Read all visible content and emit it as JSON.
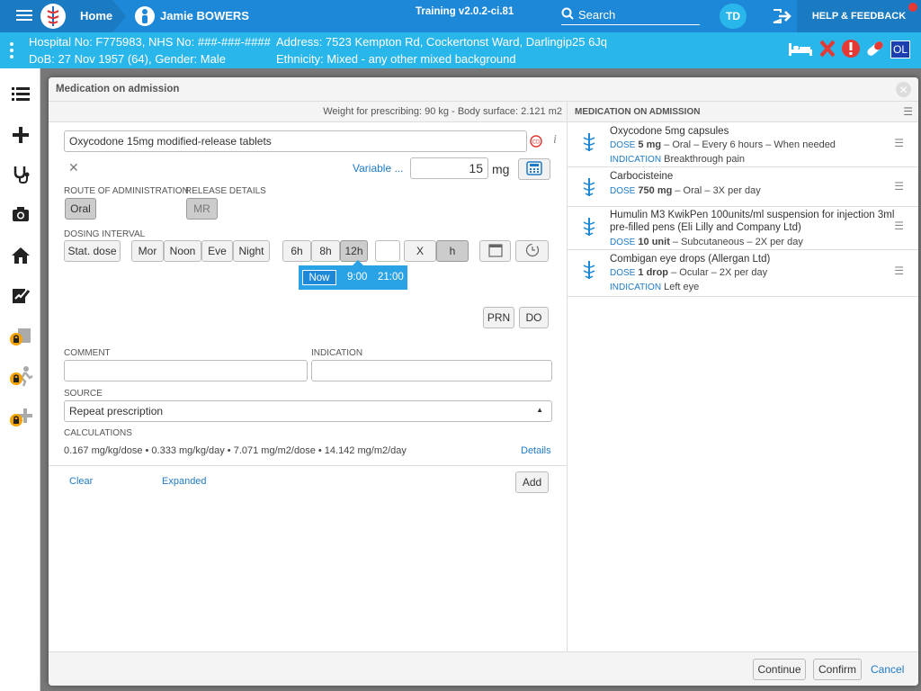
{
  "topbar": {
    "home": "Home",
    "user": "Jamie BOWERS",
    "version": "Training v2.0.2-ci.81",
    "search": "Search",
    "initials": "TD",
    "help": "HELP & FEEDBACK"
  },
  "patient": {
    "line1a": "Hospital No: F775983, NHS No: ###-###-####",
    "line1b": "Address: 7523 Kempton Rd, Cockertonst Ward, Darlingip25 6Jq",
    "line2a": "DoB: 27 Nov 1957 (64), Gender: Male",
    "line2b": "Ethnicity: Mixed - any other mixed background",
    "badge": "OL"
  },
  "modal": {
    "title": "Medication on admission",
    "weight": "Weight for prescribing: 90 kg - Body surface: 2.121 m2"
  },
  "form": {
    "drug": "Oxycodone 15mg modified-release tablets",
    "variable": "Variable ...",
    "dose": "15",
    "unit": "mg",
    "route_label": "ROUTE OF ADMINISTRATION",
    "route": "Oral",
    "release_label": "RELEASE DETAILS",
    "release": "MR",
    "interval_label": "DOSING INTERVAL",
    "stat": "Stat. dose",
    "mor": "Mor",
    "noon": "Noon",
    "eve": "Eve",
    "night": "Night",
    "h6": "6h",
    "h8": "8h",
    "h12": "12h",
    "x": "X",
    "h": "h",
    "times": {
      "now": "Now",
      "t1": "9:00",
      "t2": "21:00"
    },
    "prn": "PRN",
    "do": "DO",
    "comment_label": "COMMENT",
    "indication_label": "INDICATION",
    "source_label": "SOURCE",
    "source": "Repeat prescription",
    "calc_label": "CALCULATIONS",
    "calc": "0.167 mg/kg/dose • 0.333 mg/kg/day • 7.071 mg/m2/dose • 14.142 mg/m2/day",
    "details": "Details",
    "clear": "Clear",
    "expanded": "Expanded",
    "add": "Add"
  },
  "list": {
    "header": "MEDICATION ON ADMISSION",
    "items": [
      {
        "name": "Oxycodone 5mg capsules",
        "dose_label": "DOSE",
        "dose": "5 mg",
        "rest": " – Oral – Every 6 hours – When needed",
        "ind_label": "INDICATION",
        "ind": "Breakthrough pain"
      },
      {
        "name": "Carbocisteine",
        "dose_label": "DOSE",
        "dose": "750 mg",
        "rest": " – Oral – 3X per day"
      },
      {
        "name": "Humulin M3 KwikPen 100units/ml suspension for injection 3ml",
        "name2": "pre-filled pens (Eli Lilly and Company Ltd)",
        "dose_label": "DOSE",
        "dose": "10 unit",
        "rest": " – Subcutaneous – 2X per day"
      },
      {
        "name": "Combigan eye drops (Allergan Ltd)",
        "dose_label": "DOSE",
        "dose": "1 drop",
        "rest": " – Ocular – 2X per day",
        "ind_label": "INDICATION",
        "ind": "Left eye"
      }
    ]
  },
  "footer": {
    "continue": "Continue",
    "confirm": "Confirm",
    "cancel": "Cancel"
  }
}
